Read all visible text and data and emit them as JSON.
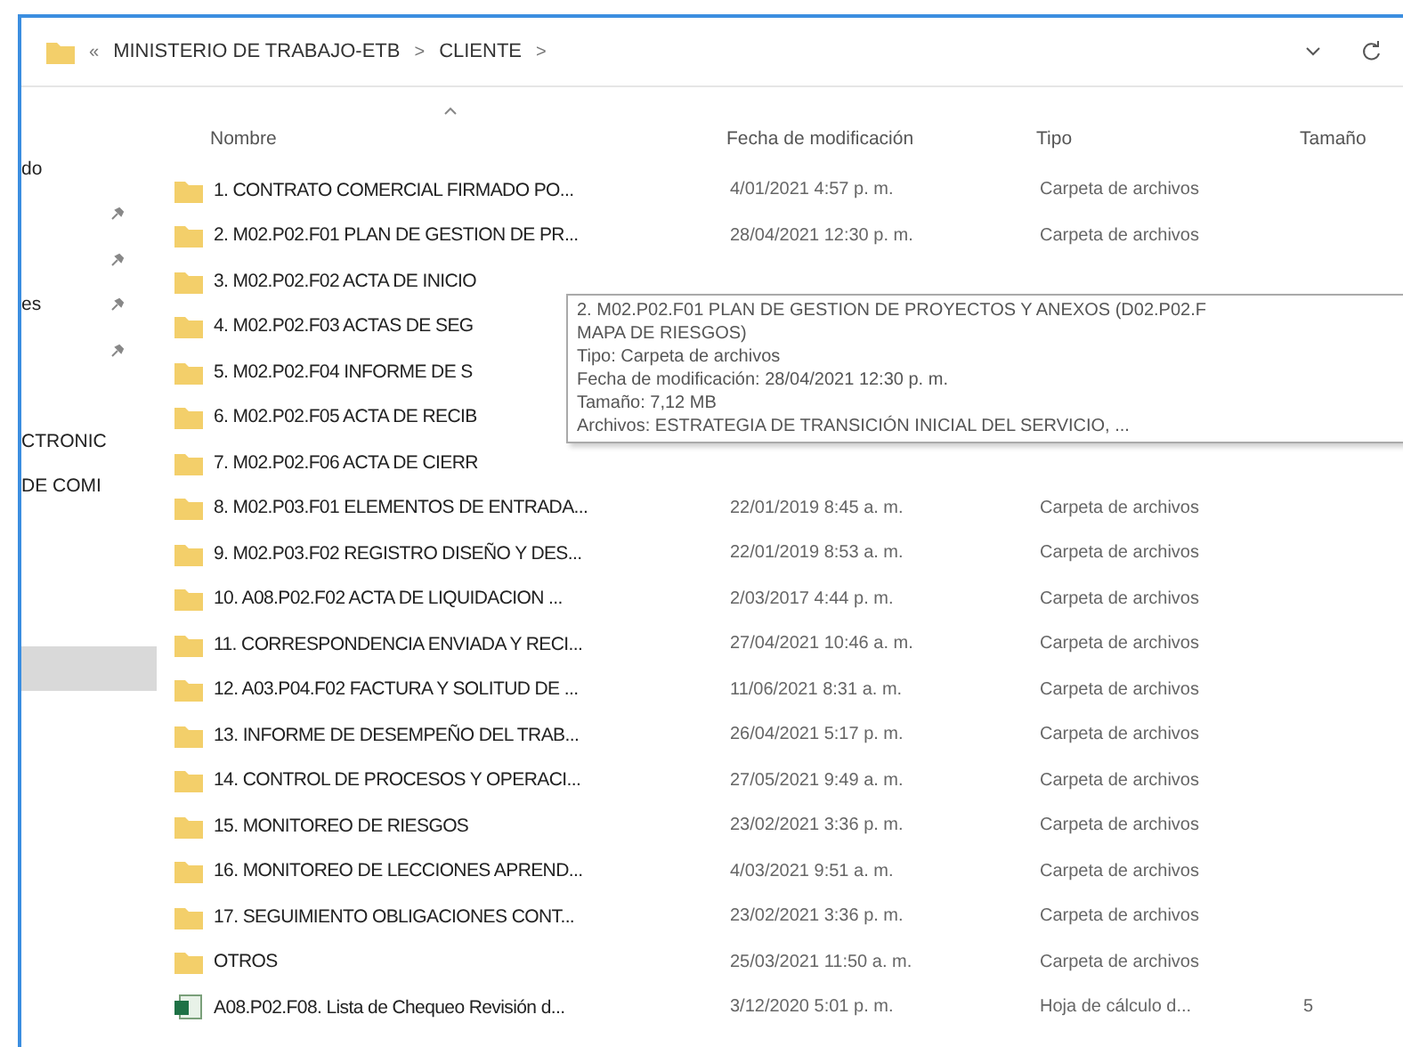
{
  "address_bar": {
    "overflow": "«",
    "path": [
      {
        "label": "MINISTERIO DE TRABAJO-ETB"
      },
      {
        "label": "CLIENTE"
      }
    ],
    "separator": ">"
  },
  "sidebar": {
    "items": [
      {
        "label": "do",
        "pinned": false,
        "selected": false
      },
      {
        "pinned": true,
        "selected": false
      },
      {
        "pinned": true,
        "selected": false
      },
      {
        "label": "es",
        "pinned": true,
        "selected": false
      },
      {
        "pinned": true,
        "selected": false
      },
      {
        "pinned": false,
        "selected": false
      },
      {
        "label": "CTRONIC",
        "pinned": false,
        "selected": false
      },
      {
        "label": "DE COMI",
        "pinned": false,
        "selected": false
      },
      {
        "pinned": false,
        "selected": false
      },
      {
        "pinned": false,
        "selected": false
      },
      {
        "pinned": false,
        "selected": false
      },
      {
        "pinned": false,
        "selected": true
      }
    ]
  },
  "columns": [
    {
      "label": "Nombre",
      "sorted": true
    },
    {
      "label": "Fecha de modificación",
      "sorted": false
    },
    {
      "label": "Tipo",
      "sorted": false
    },
    {
      "label": "Tamaño",
      "sorted": false
    }
  ],
  "rows": [
    {
      "kind": "folder",
      "name": "1. CONTRATO COMERCIAL FIRMADO PO...",
      "date": "4/01/2021 4:57 p. m.",
      "type": "Carpeta de archivos"
    },
    {
      "kind": "folder",
      "name": "2. M02.P02.F01 PLAN DE GESTION DE PR...",
      "date": "28/04/2021 12:30 p. m.",
      "type": "Carpeta de archivos"
    },
    {
      "kind": "folder",
      "name": "3. M02.P02.F02 ACTA DE INICIO"
    },
    {
      "kind": "folder",
      "name": "4. M02.P02.F03 ACTAS DE SEG"
    },
    {
      "kind": "folder",
      "name": "5. M02.P02.F04 INFORME DE S"
    },
    {
      "kind": "folder",
      "name": "6. M02.P02.F05 ACTA DE RECIB"
    },
    {
      "kind": "folder",
      "name": "7. M02.P02.F06 ACTA DE CIERR"
    },
    {
      "kind": "folder",
      "name": "8. M02.P03.F01 ELEMENTOS DE ENTRADA...",
      "date": "22/01/2019 8:45 a. m.",
      "type": "Carpeta de archivos"
    },
    {
      "kind": "folder",
      "name": "9. M02.P03.F02 REGISTRO DISEÑO Y DES...",
      "date": "22/01/2019 8:53 a. m.",
      "type": "Carpeta de archivos"
    },
    {
      "kind": "folder",
      "name": "10. A08.P02.F02 ACTA DE LIQUIDACION ...",
      "date": "2/03/2017 4:44 p. m.",
      "type": "Carpeta de archivos"
    },
    {
      "kind": "folder",
      "name": "11. CORRESPONDENCIA ENVIADA Y RECI...",
      "date": "27/04/2021 10:46 a. m.",
      "type": "Carpeta de archivos"
    },
    {
      "kind": "folder",
      "name": "12. A03.P04.F02 FACTURA Y SOLITUD DE ...",
      "date": "11/06/2021 8:31 a. m.",
      "type": "Carpeta de archivos"
    },
    {
      "kind": "folder",
      "name": "13. INFORME DE DESEMPEÑO DEL TRAB...",
      "date": "26/04/2021 5:17 p. m.",
      "type": "Carpeta de archivos"
    },
    {
      "kind": "folder",
      "name": "14. CONTROL DE PROCESOS Y OPERACI...",
      "date": "27/05/2021 9:49 a. m.",
      "type": "Carpeta de archivos"
    },
    {
      "kind": "folder",
      "name": "15. MONITOREO DE RIESGOS",
      "date": "23/02/2021 3:36 p. m.",
      "type": "Carpeta de archivos"
    },
    {
      "kind": "folder",
      "name": "16. MONITOREO DE LECCIONES APREND...",
      "date": "4/03/2021 9:51 a. m.",
      "type": "Carpeta de archivos"
    },
    {
      "kind": "folder",
      "name": "17. SEGUIMIENTO OBLIGACIONES CONT...",
      "date": "23/02/2021 3:36 p. m.",
      "type": "Carpeta de archivos"
    },
    {
      "kind": "folder",
      "name": "OTROS",
      "date": "25/03/2021 11:50 a. m.",
      "type": "Carpeta de archivos"
    },
    {
      "kind": "spreadsheet",
      "name": "A08.P02.F08. Lista de Chequeo Revisión d...",
      "date": "3/12/2020 5:01 p. m.",
      "type": "Hoja de cálculo d...",
      "size": "5"
    }
  ],
  "tooltip": {
    "lines": [
      "2. M02.P02.F01 PLAN DE GESTION DE PROYECTOS Y ANEXOS (D02.P02.F",
      "MAPA DE RIESGOS)",
      "Tipo: Carpeta de archivos",
      "Fecha de modificación: 28/04/2021 12:30 p. m.",
      "Tamaño: 7,12 MB",
      "Archivos: ESTRATEGIA DE TRANSICIÓN INICIAL DEL SERVICIO, ..."
    ]
  }
}
